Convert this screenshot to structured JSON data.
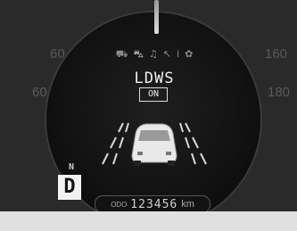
{
  "cluster": {
    "lane_system": {
      "title": "LDWS",
      "state": "ON"
    },
    "indicator_icons": [
      {
        "name": "car-icon",
        "glyph": "⛟",
        "active": false
      },
      {
        "name": "lane-car-icon",
        "glyph": "⛍",
        "active": true
      },
      {
        "name": "music-icon",
        "glyph": "♫",
        "active": false
      },
      {
        "name": "phone-icon",
        "glyph": "↖",
        "active": false
      },
      {
        "name": "info-icon",
        "glyph": "i",
        "active": false
      },
      {
        "name": "gear-icon",
        "glyph": "✿",
        "active": false
      }
    ],
    "background_scale": {
      "left_mid": "60",
      "left_low": "60",
      "right_high": "160",
      "right_mid": "180"
    },
    "gear": {
      "current": "D",
      "previous": "N"
    },
    "odometer": {
      "label": "ODO",
      "value": "123456",
      "unit": "km"
    }
  },
  "colors": {
    "text": "#f0f0f0",
    "dim_text": "#8a8a8a",
    "dial_background": "#111111"
  }
}
